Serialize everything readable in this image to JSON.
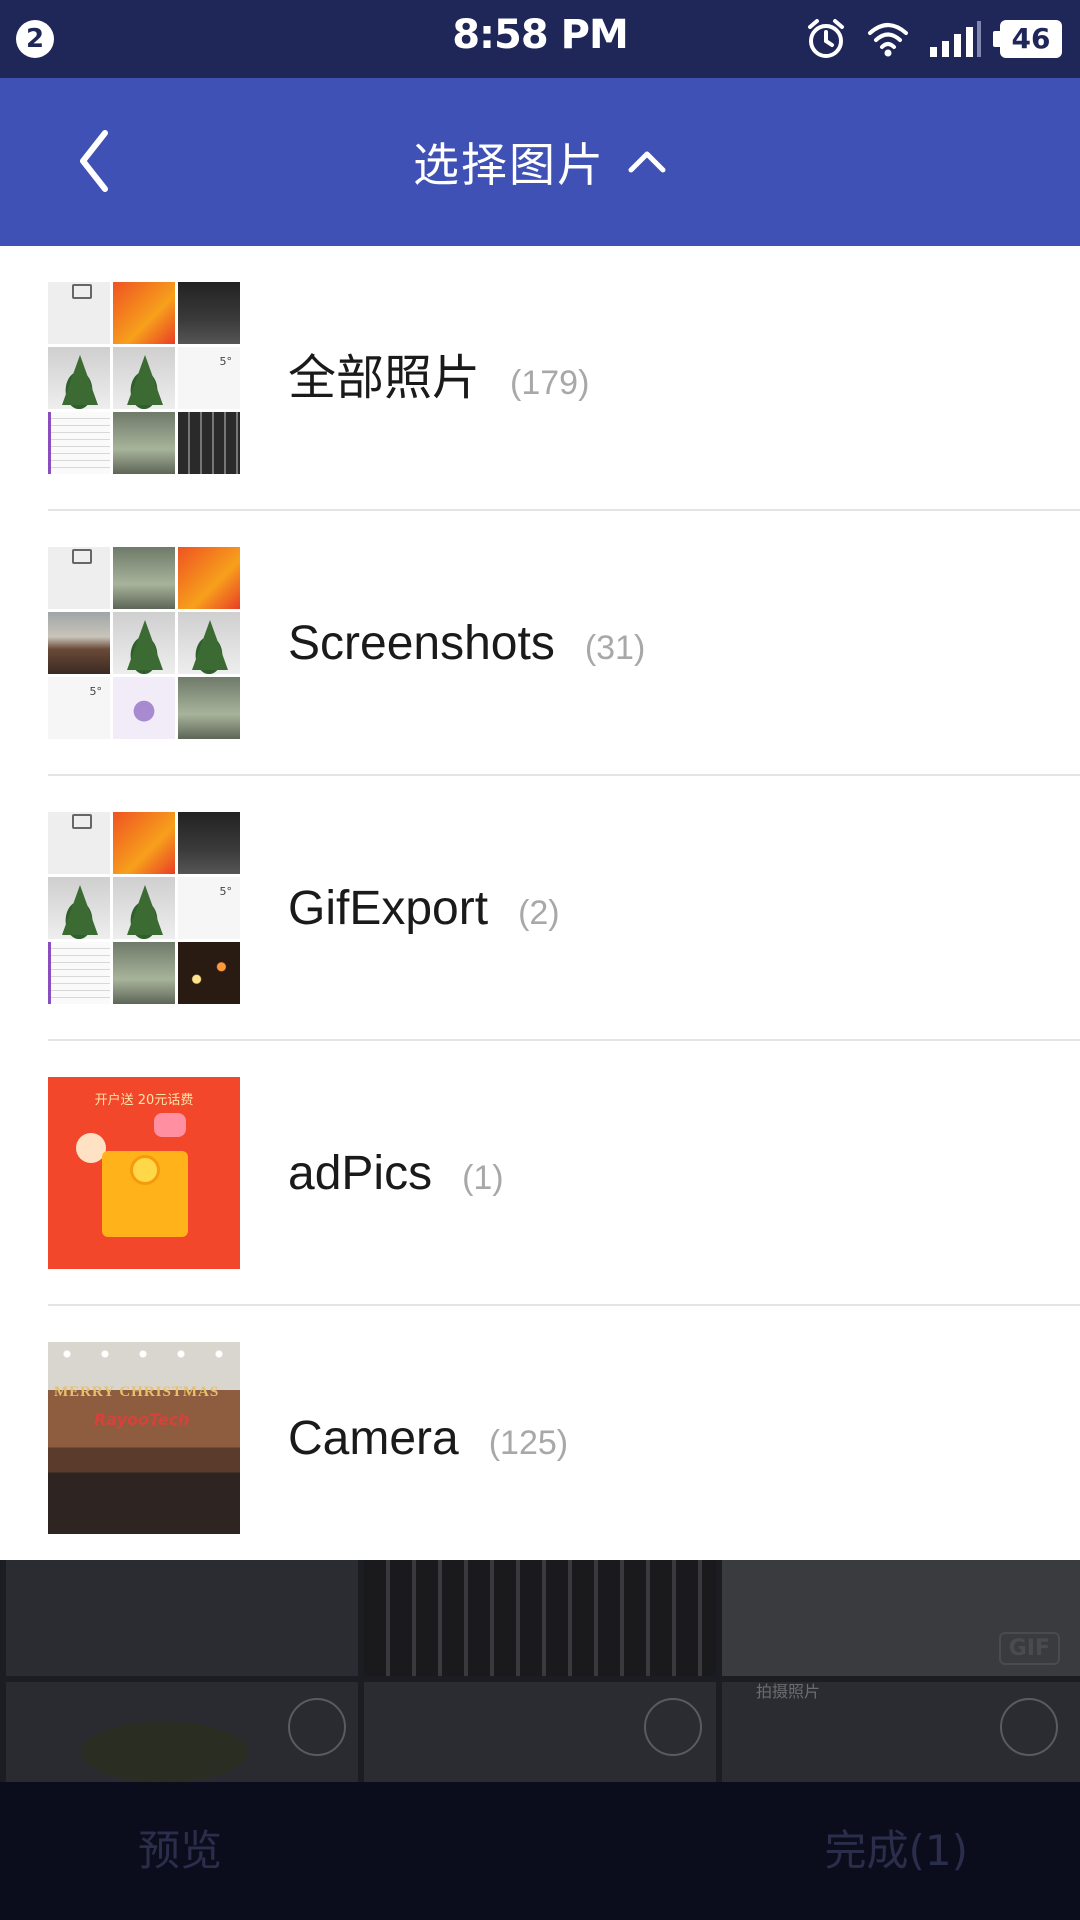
{
  "status_bar": {
    "notification_count": "2",
    "time": "8:58 PM",
    "battery": "46",
    "icons": [
      "alarm-icon",
      "wifi-icon",
      "signal-icon",
      "battery-icon"
    ]
  },
  "app_bar": {
    "title": "选择图片",
    "back_icon": "chevron-left-icon",
    "toggle_icon": "chevron-up-icon",
    "background_color": "#3f51b5"
  },
  "albums": [
    {
      "name": "全部照片",
      "count": "(179)"
    },
    {
      "name": "Screenshots",
      "count": "(31)"
    },
    {
      "name": "GifExport",
      "count": "(2)"
    },
    {
      "name": "adPics",
      "count": "(1)"
    },
    {
      "name": "Camera",
      "count": "(125)"
    }
  ],
  "ad_thumbnail": {
    "banner_text": "开户送 20元话费"
  },
  "camera_thumbnail": {
    "line1": "MERRY CHRISTMAS",
    "line2": "RayooTech"
  },
  "background": {
    "gif_badge": "GIF",
    "capture_label": "拍摄照片"
  },
  "bottom_bar": {
    "preview_label": "预览",
    "done_label": "完成(1)"
  }
}
